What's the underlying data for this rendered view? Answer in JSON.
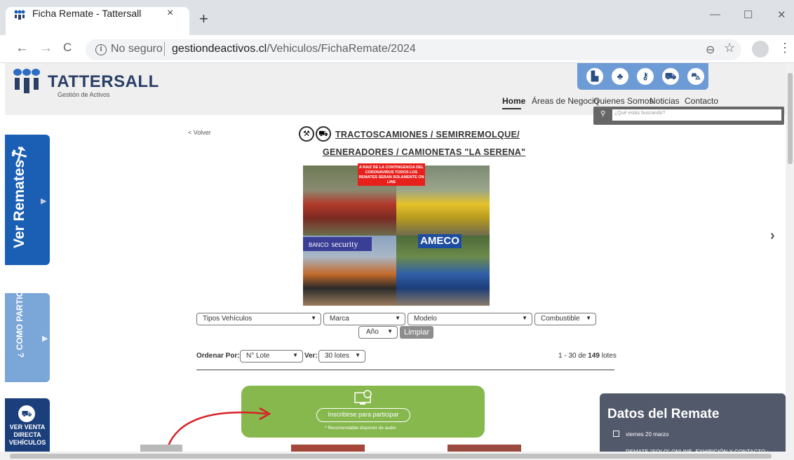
{
  "browser": {
    "tab_title": "Ficha Remate - Tattersall",
    "tab_close": "×",
    "new_tab": "+",
    "minimize": "—",
    "maximize": "☐",
    "close": "✕",
    "back": "←",
    "forward": "→",
    "reload": "C",
    "insecure_label": "No seguro",
    "url_domain": "gestiondeactivos.cl",
    "url_path": "/Vehiculos/FichaRemate/2024",
    "zoom_icon": "⊖",
    "star_icon": "☆",
    "menu_icon": "⋮"
  },
  "header": {
    "logo_text": "TATTERSALL",
    "logo_sub": "Gestión de Activos",
    "nav": [
      "Home",
      "Áreas de Negocio",
      "Quienes Somos",
      "Noticias",
      "Contacto"
    ],
    "search_placeholder": "¿Qué estás buscando?",
    "top_icons": [
      "building-icon",
      "tree-icon",
      "key-icon",
      "car-icon",
      "truck-icon"
    ]
  },
  "side": {
    "ver_remates": "Ver Remates",
    "como_participar": "¿ COMO PARTICIPAR?",
    "ver_venta": "VER VENTA DIRECTA VEHÍCULOS"
  },
  "main": {
    "volver": "< Volver",
    "title_line1": "TRACTOSCAMIONES / SEMIRREMOLQUE/",
    "title_line2": "GENERADORES / CAMIONETAS \"LA SERENA\"",
    "banner_text": "A RAIZ DE LA CONTINGENCIA DEL CORONAVIRUS TODOS LOS REMATES SERAN SOLAMENTE ON LINE",
    "banco_label": "BANCO",
    "banco_brand": "security",
    "ameco_label": "AMECO"
  },
  "filters": {
    "tipos": "Tipos Vehículos",
    "marca": "Marca",
    "modelo": "Modelo",
    "combustible": "Combustible",
    "anio": "Año",
    "limpiar": "Limpiar",
    "ordenar_label": "Ordenar Por:",
    "ordenar_value": "N° Lote",
    "ver_label": "Ver:",
    "ver_value": "30 lotes",
    "count_prefix": "1 - 30 de ",
    "count_total": "149",
    "count_suffix": " lotes"
  },
  "cta": {
    "button": "Inscribirse para participar",
    "note": "* Recomendable disponer de audio"
  },
  "datos": {
    "title": "Datos del Remate",
    "date": "viernes 20 marzo",
    "info": "REMATE \"SOLO\" ONLINE, EXHIBICIÓN Y CONTACTO :"
  },
  "colors": {
    "accent_blue": "#1a5fb4",
    "cta_green": "#86b84e",
    "datos_bg": "#52596b"
  }
}
